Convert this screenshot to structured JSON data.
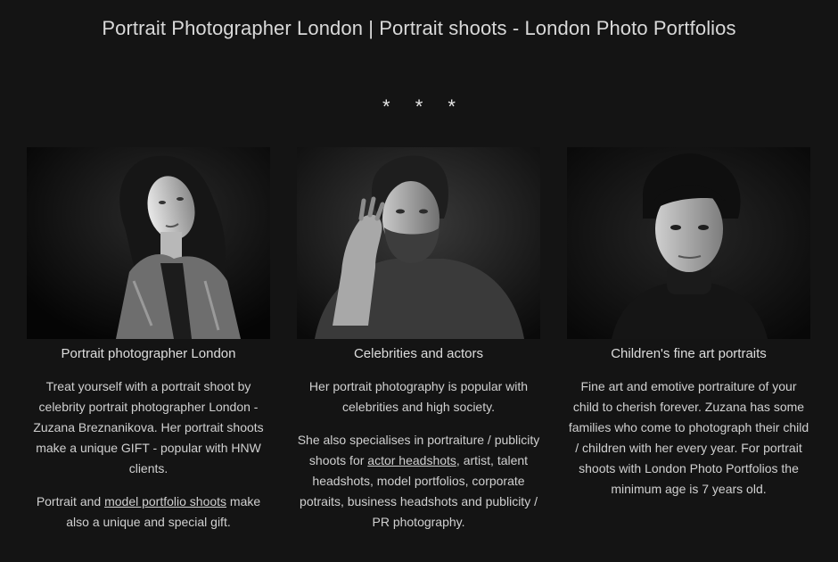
{
  "header": {
    "title": "Portrait Photographer London | Portrait shoots - London Photo Portfolios",
    "divider": [
      "*",
      "*",
      "*"
    ]
  },
  "cards": [
    {
      "image_subject": "portrait-woman-denim-jacket",
      "title": "Portrait photographer London",
      "p1": "Treat yourself with a portrait shoot by celebrity portrait photographer London - Zuzana Breznanikova. Her portrait shoots make a unique GIFT - popular with HNW clients.",
      "p2_before": "Portrait and ",
      "p2_link": "model portfolio shoots",
      "p2_after": " make also a unique and special gift."
    },
    {
      "image_subject": "portrait-bearded-man",
      "title": "Celebrities and actors",
      "p1": "Her portrait photography is popular with celebrities and high society.",
      "p2_before": "She also specialises in portraiture / publicity shoots for ",
      "p2_link": "actor headshots",
      "p2_after": ", artist, talent headshots, model portfolios, corporate potraits, business headshots and publicity / PR photography."
    },
    {
      "image_subject": "portrait-boy-turtleneck",
      "title": "Children's fine art portraits",
      "p1": "Fine art and emotive portraiture of your child to cherish forever. Zuzana has some families who come to photograph their child / children with her every year. For portrait shoots with London Photo Portfolios the minimum age is 7 years old."
    }
  ],
  "colors": {
    "background": "#141414",
    "text": "#d6d6d6"
  }
}
